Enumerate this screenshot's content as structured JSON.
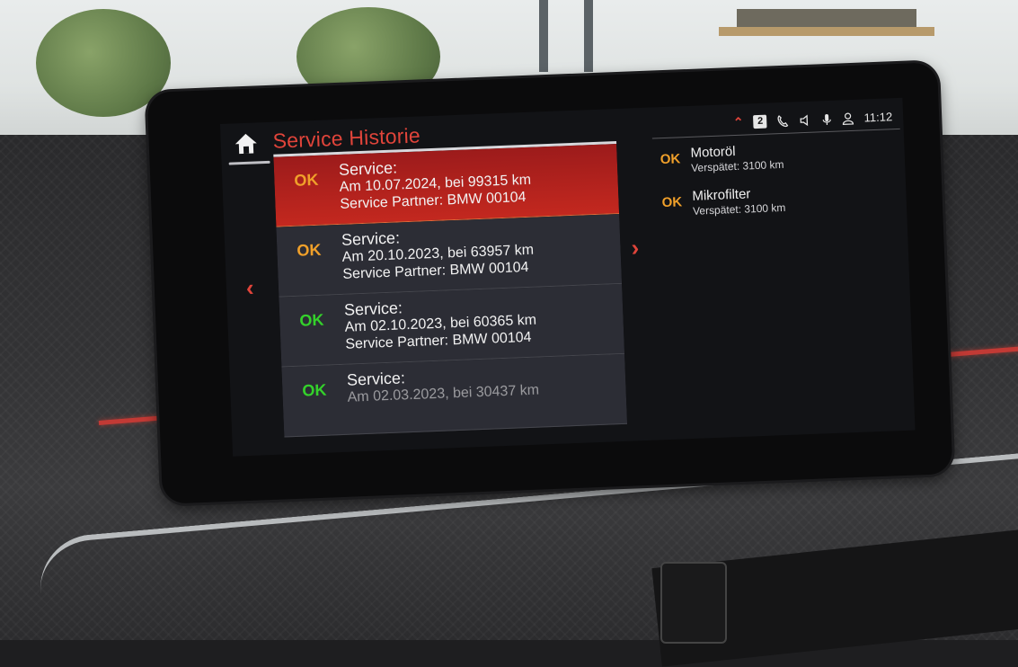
{
  "header": {
    "title": "Service Historie",
    "time": "11:12",
    "badge": "2"
  },
  "service_list": [
    {
      "status": "OK",
      "status_color": "#f0a02a",
      "label": "Service:",
      "date_line": "Am 10.07.2024, bei 99315 km",
      "partner_line": "Service Partner: BMW 00104",
      "selected": true
    },
    {
      "status": "OK",
      "status_color": "#f0a02a",
      "label": "Service:",
      "date_line": "Am 20.10.2023, bei 63957 km",
      "partner_line": "Service Partner: BMW 00104",
      "selected": false
    },
    {
      "status": "OK",
      "status_color": "#34d12b",
      "label": "Service:",
      "date_line": "Am 02.10.2023, bei 60365 km",
      "partner_line": "Service Partner: BMW 00104",
      "selected": false
    },
    {
      "status": "OK",
      "status_color": "#34d12b",
      "label": "Service:",
      "date_line": "Am 02.03.2023, bei 30437 km",
      "partner_line": "",
      "selected": false
    }
  ],
  "details": [
    {
      "status": "OK",
      "name": "Motoröl",
      "note": "Verspätet: 3100 km"
    },
    {
      "status": "OK",
      "name": "Mikrofilter",
      "note": "Verspätet: 3100 km"
    }
  ],
  "colors": {
    "accent": "#e0443a",
    "ok_orange": "#f0a02a",
    "ok_green": "#34d12b",
    "selection": "#c3281f"
  },
  "icons": [
    "home-icon",
    "chevron-up-icon",
    "phone-icon",
    "speaker-icon",
    "microphone-icon",
    "user-icon",
    "chevron-left-icon",
    "chevron-right-icon"
  ]
}
